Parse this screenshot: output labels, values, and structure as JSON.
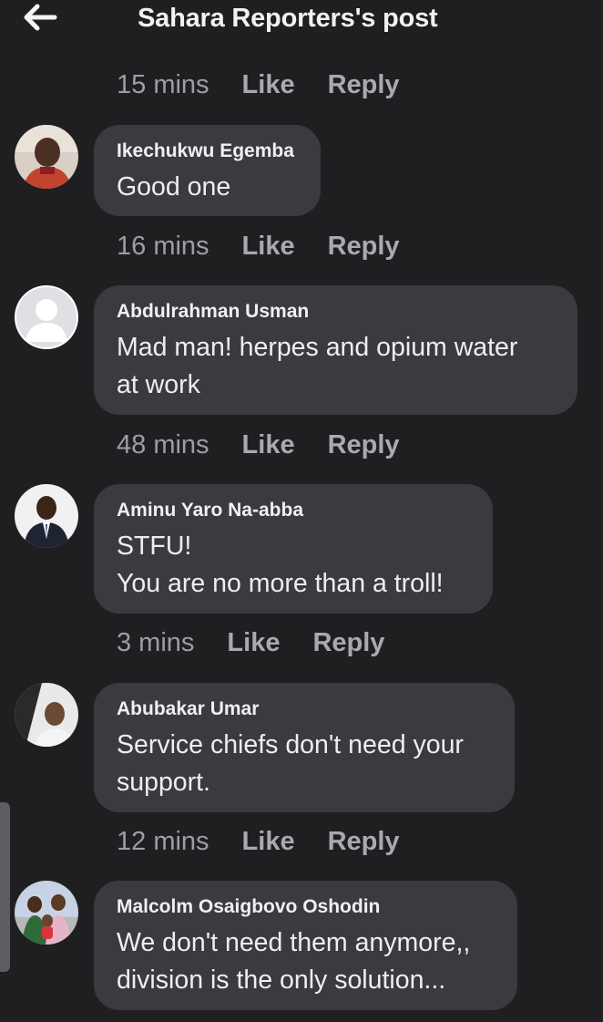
{
  "header": {
    "title": "Sahara Reporters's post",
    "back_icon": "arrow-left-icon"
  },
  "actions": {
    "like_label": "Like",
    "reply_label": "Reply"
  },
  "top_meta": {
    "time": "15 mins"
  },
  "comments": [
    {
      "author": "Ikechukwu Egemba",
      "text": "Good one",
      "time": "16 mins",
      "avatar": "user-photo-icon"
    },
    {
      "author": "Abdulrahman Usman",
      "text": "Mad man! herpes and opium water\nat work",
      "time": "48 mins",
      "avatar": "default-profile-icon"
    },
    {
      "author": "Aminu Yaro Na-abba",
      "text": "STFU!\nYou are no more than a troll!",
      "time": "3 mins",
      "avatar": "user-photo-icon"
    },
    {
      "author": "Abubakar Umar",
      "text": "Service chiefs don't need your\nsupport.",
      "time": "12 mins",
      "avatar": "user-photo-icon"
    },
    {
      "author": "Malcolm Osaigbovo Oshodin",
      "text": "We don't need them anymore,,\ndivision is the only solution...",
      "time": "",
      "avatar": "user-photo-icon"
    }
  ],
  "colors": {
    "background": "#1f1f21",
    "bubble": "#3a3b3e",
    "meta_text": "#9c9ea3"
  }
}
